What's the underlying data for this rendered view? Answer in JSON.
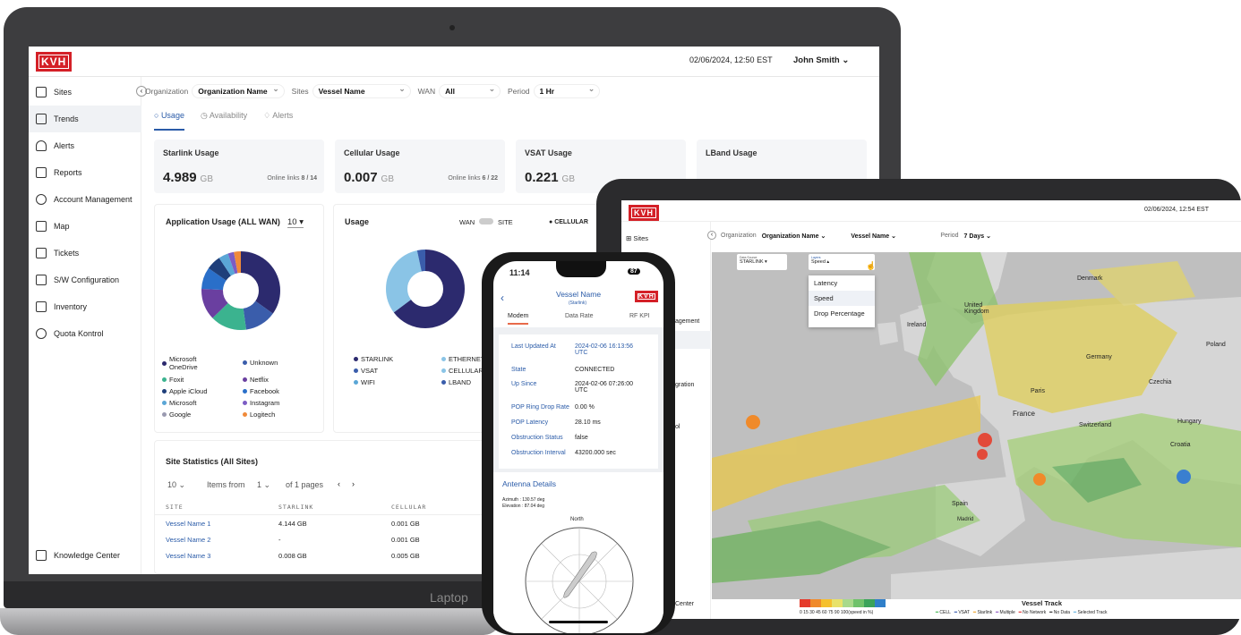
{
  "laptop": {
    "brand_label": "Laptop",
    "app": {
      "logo": "KVH",
      "datetime": "02/06/2024, 12:50 EST",
      "user": "John Smith",
      "sidebar": [
        {
          "label": "Sites",
          "icon": "grid-icon"
        },
        {
          "label": "Trends",
          "icon": "monitor-icon",
          "active": true
        },
        {
          "label": "Alerts",
          "icon": "bell-icon"
        },
        {
          "label": "Reports",
          "icon": "report-icon"
        },
        {
          "label": "Account Management",
          "icon": "users-icon"
        },
        {
          "label": "Map",
          "icon": "map-icon"
        },
        {
          "label": "Tickets",
          "icon": "ticket-icon"
        },
        {
          "label": "S/W Configuration",
          "icon": "config-icon"
        },
        {
          "label": "Inventory",
          "icon": "inventory-icon"
        },
        {
          "label": "Quota Kontrol",
          "icon": "quota-icon"
        }
      ],
      "knowledge_center": "Knowledge Center",
      "filters": {
        "org_label": "Organization",
        "org_value": "Organization Name",
        "sites_label": "Sites",
        "sites_value": "Vessel Name",
        "wan_label": "WAN",
        "wan_value": "All",
        "period_label": "Period",
        "period_value": "1 Hr"
      },
      "tabs": [
        "Usage",
        "Availability",
        "Alerts"
      ],
      "usage_cards": [
        {
          "title": "Starlink Usage",
          "value": "4.989",
          "unit": "GB",
          "online": "Online links",
          "online_value": "8 / 14"
        },
        {
          "title": "Cellular Usage",
          "value": "0.007",
          "unit": "GB",
          "online": "Online links",
          "online_value": "6 / 22"
        },
        {
          "title": "VSAT Usage",
          "value": "0.221",
          "unit": "GB"
        },
        {
          "title": "LBand Usage"
        }
      ],
      "app_usage": {
        "title": "Application Usage (ALL WAN)",
        "top": "10",
        "legend": [
          {
            "label": "Microsoft OneDrive",
            "color": "#2c2a6e"
          },
          {
            "label": "Unknown",
            "color": "#3a5dab"
          },
          {
            "label": "Foxit",
            "color": "#3bb38f"
          },
          {
            "label": "Netflix",
            "color": "#6a3fa0"
          },
          {
            "label": "Apple iCloud",
            "color": "#1f3f7a"
          },
          {
            "label": "Facebook",
            "color": "#2a6fc9"
          },
          {
            "label": "Microsoft",
            "color": "#5aa6d6"
          },
          {
            "label": "Instagram",
            "color": "#7c5cc4"
          },
          {
            "label": "Google",
            "color": "#9a9ab0"
          },
          {
            "label": "Logitech",
            "color": "#f08a3a"
          }
        ]
      },
      "usage_panel": {
        "title": "Usage",
        "wan": "WAN",
        "site": "SITE",
        "cellular": "CELLULAR",
        "legend": [
          "STARLINK",
          "ETHERNET",
          "VSAT",
          "CELLULAR",
          "WIFI",
          "LBAND"
        ]
      },
      "site_stats": {
        "title": "Site Statistics (All Sites)",
        "per_page": "10",
        "items_from": "Items from",
        "page": "1",
        "of_pages": "of 1 pages",
        "columns": [
          "SITE",
          "STARLINK",
          "CELLULAR"
        ],
        "rows": [
          [
            "Vessel Name 1",
            "4.144 GB",
            "0.001 GB"
          ],
          [
            "Vessel Name 2",
            "-",
            "0.001 GB"
          ],
          [
            "Vessel Name 3",
            "0.008 GB",
            "0.005 GB"
          ]
        ]
      }
    }
  },
  "tablet": {
    "logo": "KVH",
    "datetime": "02/06/2024, 12:54 EST",
    "sidebar_sites": "Sites",
    "sidebar_partial": [
      "agement",
      "gration",
      "ol",
      "Center"
    ],
    "filters": {
      "org_label": "Organization",
      "org_value": "Organization Name",
      "site_value": "Vessel Name",
      "period_label": "Period",
      "period_value": "7 Days"
    },
    "data_source_label": "Data Source",
    "data_source": "STARLINK",
    "layer_label": "Layers",
    "layer": "Speed",
    "layer_options": [
      "Latency",
      "Speed",
      "Drop Percentage"
    ],
    "map_labels": [
      "Denmark",
      "Ireland",
      "United Kingdom",
      "Poland",
      "Germany",
      "Czechia",
      "Paris",
      "France",
      "Switzerland",
      "Hungary",
      "Croatia",
      "Spain",
      "Madrid"
    ],
    "vessel_track": "Vessel Track",
    "scale": "0  15  30  45  60  75  90  100(speed in %)",
    "track_legend": [
      "CELL",
      "VSAT",
      "Starlink",
      "Multiple",
      "No Network",
      "No Data",
      "Selected Track"
    ],
    "scale_colors": [
      "#e53b2c",
      "#f08a2a",
      "#f5c02e",
      "#e8e26a",
      "#a8d98a",
      "#6fc26a",
      "#3aa35a",
      "#2f7fc9"
    ]
  },
  "phone": {
    "time": "11:14",
    "battery": "87",
    "title": "Vessel Name",
    "subtitle": "(Starlink)",
    "logo": "KVH",
    "tabs": [
      "Modem",
      "Data Rate",
      "RF KPI"
    ],
    "rows": [
      [
        "Last Updated At",
        "2024-02-06 16:13:56 UTC"
      ],
      [
        "State",
        "CONNECTED"
      ],
      [
        "Up Since",
        "2024-02-06 07:26:00 UTC"
      ],
      [
        "POP Ring Drop Rate",
        "0.00 %"
      ],
      [
        "POP Latency",
        "28.10 ms"
      ],
      [
        "Obstruction Status",
        "false"
      ],
      [
        "Obstruction Interval",
        "43200.000 sec"
      ]
    ],
    "antenna_title": "Antenna Details",
    "azimuth": "Azimuth : 130.57 deg",
    "elevation": "Elevation : 87.04 deg",
    "north": "North"
  }
}
